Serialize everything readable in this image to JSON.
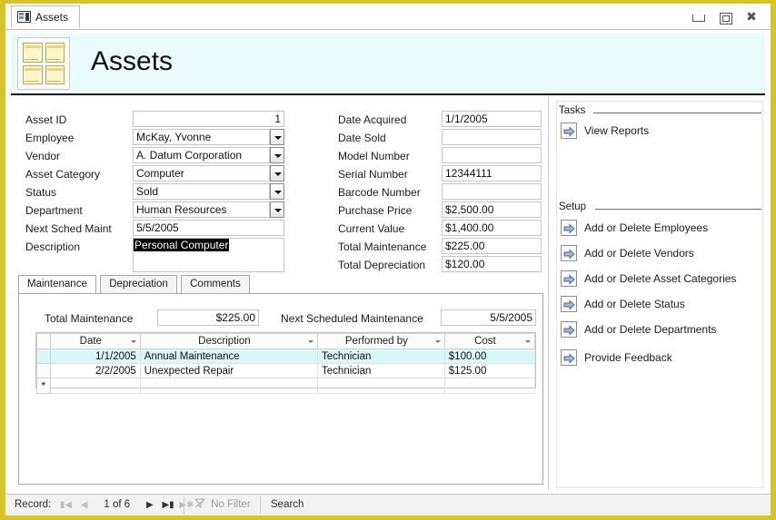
{
  "window": {
    "doc_tab_label": "Assets",
    "doc_tab_icon": "table-icon",
    "buttons": {
      "minimize": "minimize-button",
      "restore": "restore-button",
      "close": "close-button"
    }
  },
  "banner": {
    "title": "Assets",
    "icon": "assets-logo-icon"
  },
  "form": {
    "left_fields": [
      {
        "label": "Asset ID",
        "value": "1",
        "type": "text",
        "align": "right"
      },
      {
        "label": "Employee",
        "value": "McKay, Yvonne",
        "type": "combo"
      },
      {
        "label": "Vendor",
        "value": "A. Datum Corporation",
        "type": "combo"
      },
      {
        "label": "Asset Category",
        "value": "Computer",
        "type": "combo"
      },
      {
        "label": "Status",
        "value": "Sold",
        "type": "combo"
      },
      {
        "label": "Department",
        "value": "Human Resources",
        "type": "combo"
      },
      {
        "label": "Next Sched Maint",
        "value": "5/5/2005",
        "type": "text"
      },
      {
        "label": "Description",
        "value": "Personal Computer",
        "type": "textarea",
        "selected": true
      }
    ],
    "right_fields": [
      {
        "label": "Date Acquired",
        "value": "1/1/2005"
      },
      {
        "label": "Date Sold",
        "value": ""
      },
      {
        "label": "Model Number",
        "value": ""
      },
      {
        "label": "Serial Number",
        "value": "12344111"
      },
      {
        "label": "Barcode Number",
        "value": ""
      },
      {
        "label": "Purchase Price",
        "value": "$2,500.00"
      },
      {
        "label": "Current Value",
        "value": "$1,400.00"
      },
      {
        "label": "Total Maintenance",
        "value": "$225.00"
      },
      {
        "label": "Total Depreciation",
        "value": "$120.00"
      }
    ]
  },
  "tabs": {
    "items": [
      "Maintenance",
      "Depreciation",
      "Comments"
    ],
    "active_index": 0
  },
  "maintenance": {
    "total_label": "Total Maintenance",
    "total_value": "$225.00",
    "next_label": "Next Scheduled Maintenance",
    "next_value": "5/5/2005",
    "columns": [
      "Date",
      "Description",
      "Performed by",
      "Cost"
    ],
    "rows": [
      {
        "date": "1/1/2005",
        "description": "Annual Maintenance",
        "performed_by": "Technician",
        "cost": "$100.00",
        "highlighted": true
      },
      {
        "date": "2/2/2005",
        "description": "Unexpected Repair",
        "performed_by": "Technician",
        "cost": "$125.00",
        "highlighted": false
      }
    ],
    "new_row_marker": "*"
  },
  "right_panel": {
    "tasks_group_label": "Tasks",
    "tasks": [
      {
        "label": "View Reports",
        "icon": "arrow-right-icon"
      }
    ],
    "setup_group_label": "Setup",
    "setup": [
      {
        "label": "Add or Delete Employees",
        "icon": "arrow-right-icon"
      },
      {
        "label": "Add or Delete Vendors",
        "icon": "arrow-right-icon"
      },
      {
        "label": "Add or Delete Asset Categories",
        "icon": "arrow-right-icon"
      },
      {
        "label": "Add or Delete Status",
        "icon": "arrow-right-icon"
      },
      {
        "label": "Add or Delete Departments",
        "icon": "arrow-right-icon"
      }
    ],
    "extra": [
      {
        "label": "Provide Feedback",
        "icon": "arrow-right-icon"
      }
    ]
  },
  "statusbar": {
    "record_label": "Record:",
    "position": "1 of 6",
    "filter_label": "No Filter",
    "search_label": "Search",
    "nav": {
      "first": "◀|",
      "prev": "◀",
      "next": "▶",
      "last": "▶|",
      "new": "▶*"
    }
  },
  "colors": {
    "window_border": "#d9c427",
    "banner_bg": "#eafbfb",
    "row_highlight": "#d9f7f7",
    "selection_bg": "#000000"
  }
}
